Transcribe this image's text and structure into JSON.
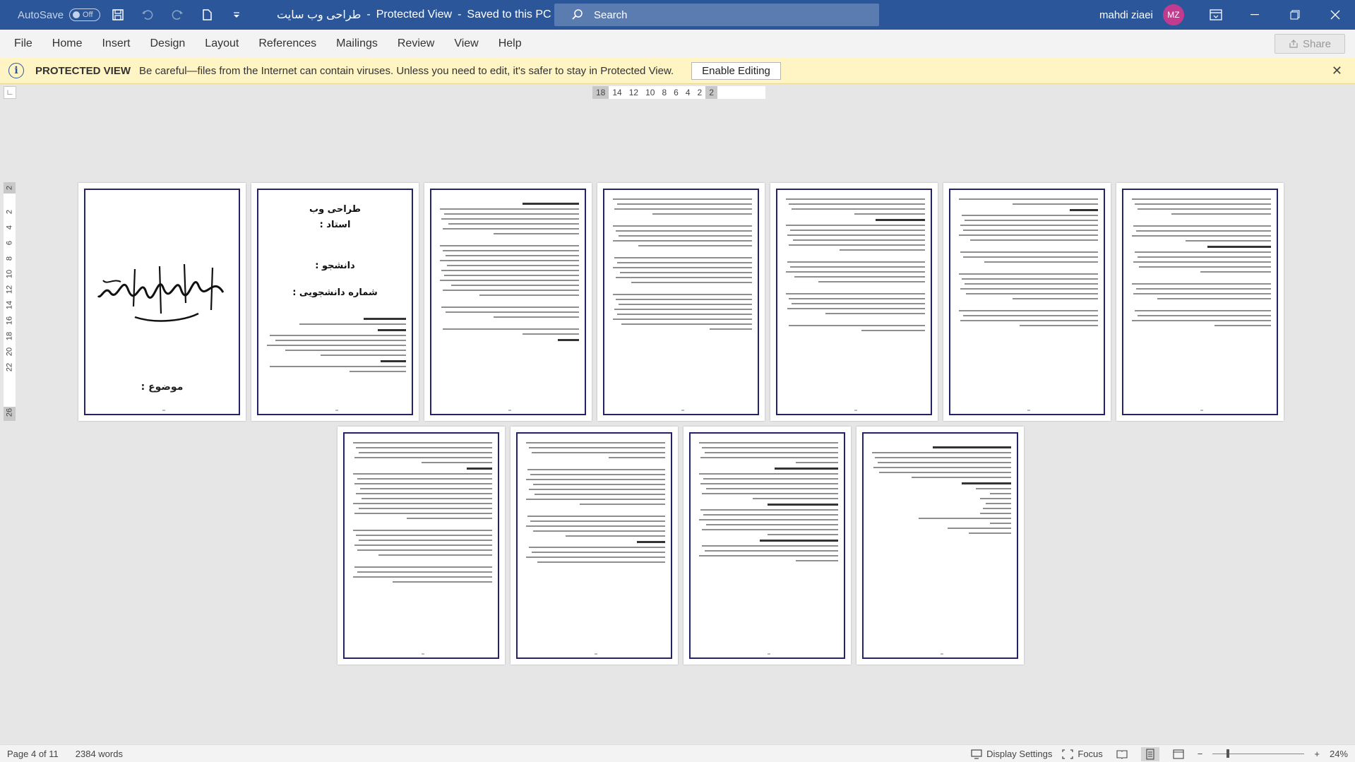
{
  "titlebar": {
    "autosave_label": "AutoSave",
    "autosave_state": "Off",
    "doc_title": "طراحی وب سایت",
    "view_state": "Protected View",
    "save_state": "Saved to this PC",
    "search_placeholder": "Search",
    "user_name": "mahdi ziaei",
    "user_initials": "MZ"
  },
  "menu": {
    "items": [
      "File",
      "Home",
      "Insert",
      "Design",
      "Layout",
      "References",
      "Mailings",
      "Review",
      "View",
      "Help"
    ],
    "share_label": "Share"
  },
  "protected_bar": {
    "title": "PROTECTED VIEW",
    "message": "Be careful—files from the Internet can contain viruses. Unless you need to edit, it's safer to stay in Protected View.",
    "button": "Enable Editing"
  },
  "ruler": {
    "horizontal": [
      "18",
      "14",
      "12",
      "10",
      "8",
      "6",
      "4",
      "2",
      "2"
    ],
    "vertical": [
      "2",
      "2",
      "4",
      "6",
      "8",
      "10",
      "12",
      "14",
      "16",
      "18",
      "20",
      "22",
      "26"
    ]
  },
  "pages": {
    "cover_topic": "موضوع :",
    "title_page": {
      "title": "طراحی وب",
      "teacher": "استاد :",
      "student": "دانشجو :",
      "student_number": "شماره دانشجویی :"
    }
  },
  "statusbar": {
    "page": "Page 4 of 11",
    "words": "2384 words",
    "display_settings": "Display Settings",
    "focus": "Focus",
    "zoom": "24%"
  },
  "colors": {
    "titlebar": "#2b579a",
    "page_border": "#24226b",
    "protected_bar": "#fff4c3",
    "avatar": "#c23b8e"
  }
}
